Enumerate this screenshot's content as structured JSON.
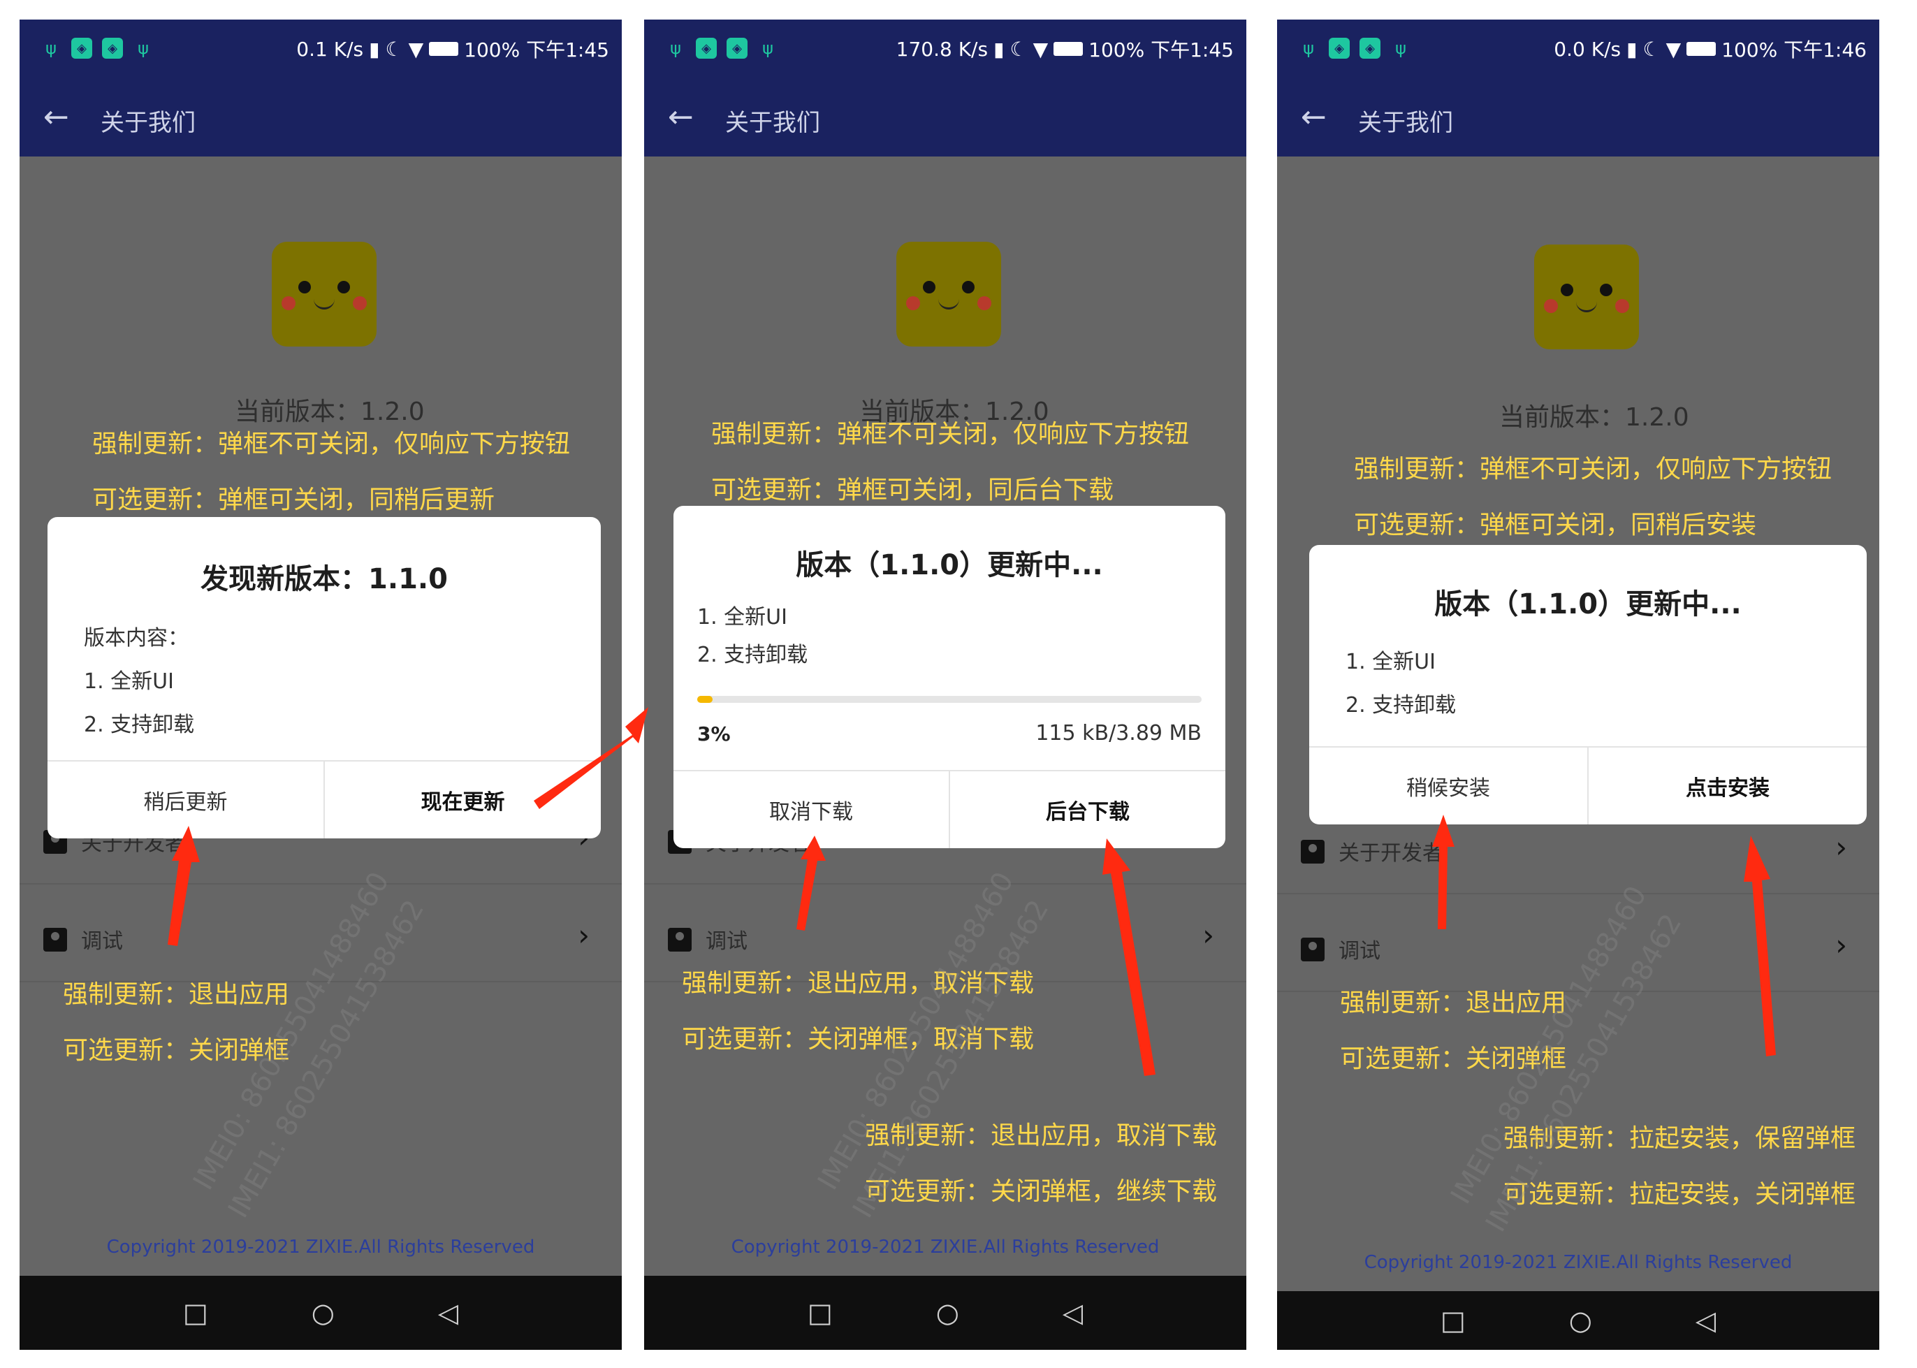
{
  "common": {
    "page_title": "关于我们",
    "version_label": "当前版本：1.2.0",
    "row_about": "关于开发者",
    "row_debug": "调试",
    "copyright": "Copyright 2019-2021 ZIXIE.All Rights Reserved",
    "watermark_1": "IMEI0: 860255041488460",
    "watermark_2": "IMEI1: 860255041538462",
    "accent_color": "#ffd84a",
    "arrow_color": "#ff2a10",
    "bar_color": "#1a2260",
    "icons": [
      "back-arrow-icon",
      "usb-icon",
      "app-notification-icon",
      "signal-icon",
      "moon-icon",
      "wifi-icon",
      "battery-icon",
      "person-card-icon",
      "chevron-right-icon",
      "nav-recent-icon",
      "nav-home-icon",
      "nav-back-icon"
    ]
  },
  "screens": [
    {
      "status_speed": "0.1 K/s",
      "status_time": "100% 下午1:45",
      "ann_top_1": "强制更新：弹框不可关闭，仅响应下方按钮",
      "ann_top_2": "可选更新：弹框可关闭，同稍后更新",
      "dialog": {
        "title": "发现新版本：1.1.0",
        "content_header": "版本内容：",
        "items": [
          "1. 全新UI",
          "2. 支持卸载"
        ],
        "btn_left": "稍后更新",
        "btn_right": "现在更新"
      },
      "ann_bottom_1": "强制更新：退出应用",
      "ann_bottom_2": "可选更新：关闭弹框"
    },
    {
      "status_speed": "170.8 K/s",
      "status_time": "100% 下午1:45",
      "ann_top_1": "强制更新：弹框不可关闭，仅响应下方按钮",
      "ann_top_2": "可选更新：弹框可关闭，同后台下载",
      "dialog": {
        "title": "版本（1.1.0）更新中...",
        "items": [
          "1. 全新UI",
          "2. 支持卸载"
        ],
        "progress": 0.03,
        "progress_label": "3%",
        "size_label": "115 kB/3.89 MB",
        "btn_left": "取消下载",
        "btn_right": "后台下载"
      },
      "ann_bottom_1": "强制更新：退出应用，取消下载",
      "ann_bottom_2": "可选更新：关闭弹框，取消下载",
      "ann_bottom_3": "强制更新：退出应用，取消下载",
      "ann_bottom_4": "可选更新：关闭弹框，继续下载"
    },
    {
      "status_speed": "0.0 K/s",
      "status_time": "100% 下午1:46",
      "ann_top_1": "强制更新：弹框不可关闭，仅响应下方按钮",
      "ann_top_2": "可选更新：弹框可关闭，同稍后安装",
      "dialog": {
        "title": "版本（1.1.0）更新中...",
        "items": [
          "1. 全新UI",
          "2. 支持卸载"
        ],
        "btn_left": "稍候安装",
        "btn_right": "点击安装"
      },
      "ann_bottom_1": "强制更新：退出应用",
      "ann_bottom_2": "可选更新：关闭弹框",
      "ann_bottom_3": "强制更新：拉起安装，保留弹框",
      "ann_bottom_4": "可选更新：拉起安装，关闭弹框"
    }
  ]
}
